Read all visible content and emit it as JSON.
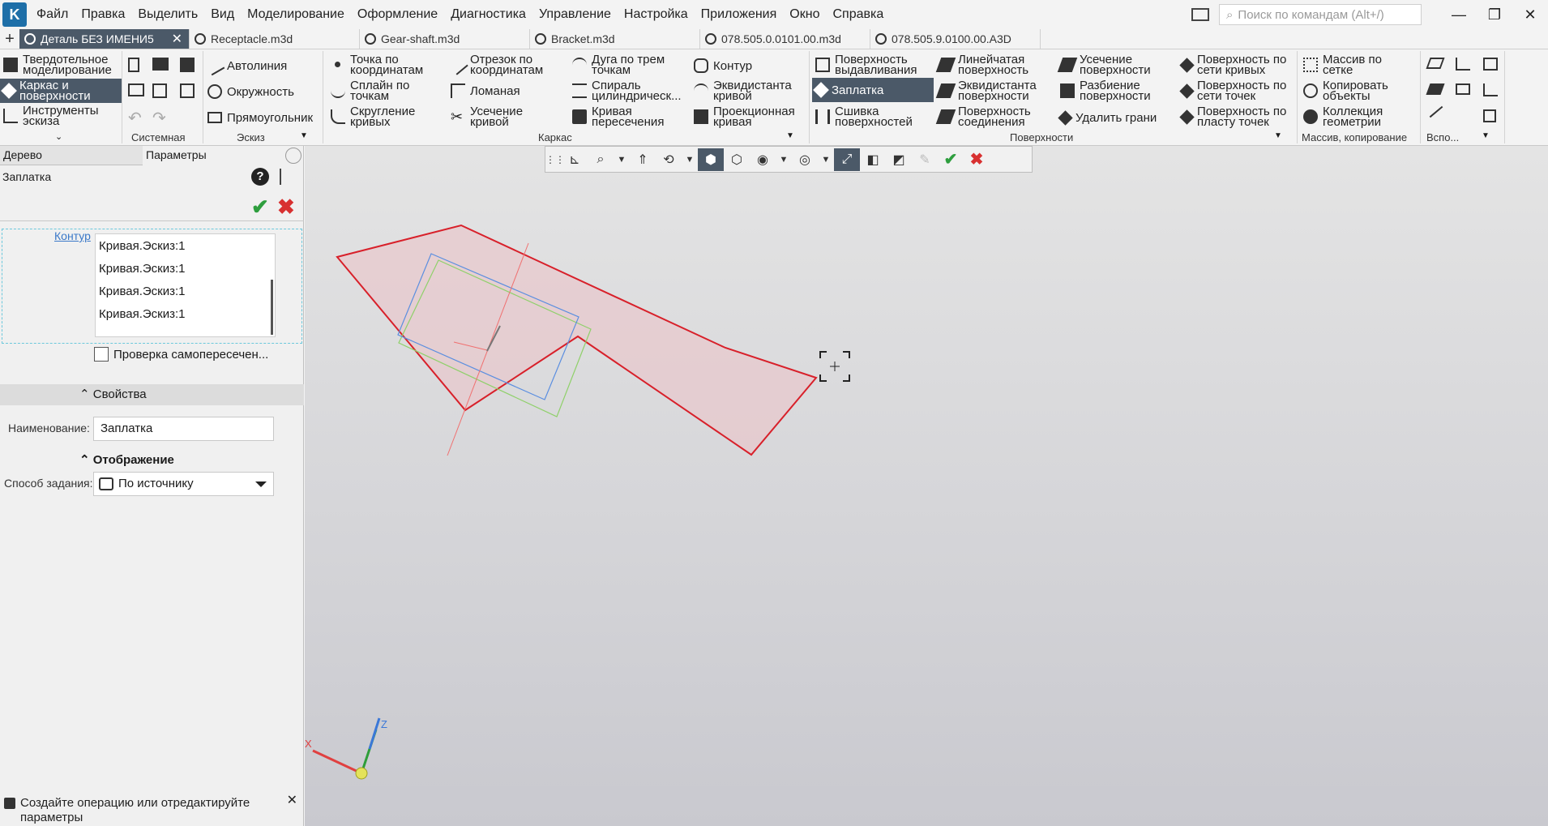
{
  "app": {
    "menu": [
      "Файл",
      "Правка",
      "Выделить",
      "Вид",
      "Моделирование",
      "Оформление",
      "Диагностика",
      "Управление",
      "Настройка",
      "Приложения",
      "Окно",
      "Справка"
    ],
    "search_placeholder": "Поиск по командам (Alt+/)",
    "window_controls": [
      "—",
      "❐",
      "✕"
    ]
  },
  "tabs": [
    {
      "label": "Деталь БЕЗ ИМЕНИ5",
      "active": true
    },
    {
      "label": "Receptacle.m3d",
      "active": false
    },
    {
      "label": "Gear-shaft.m3d",
      "active": false
    },
    {
      "label": "Bracket.m3d",
      "active": false
    },
    {
      "label": "078.505.0.0101.00.m3d",
      "active": false
    },
    {
      "label": "078.505.9.0100.00.А3D",
      "active": false
    }
  ],
  "ribbon": {
    "modes": {
      "solid": "Твердотельное моделирование",
      "frame": "Каркас и поверхности",
      "sketch_tools": "Инструменты эскиза"
    },
    "sketch": {
      "autoline": "Автолиния",
      "circle": "Окружность",
      "rect": "Прямоугольник"
    },
    "frame": {
      "point_coords": "Точка по координатам",
      "spline_points": "Сплайн по точкам",
      "round_curves": "Скругление кривых",
      "segment_coords": "Отрезок по координатам",
      "polyline": "Ломаная",
      "trim_curve": "Усечение кривой",
      "arc_3pts": "Дуга по трем точкам",
      "cyl_spiral": "Спираль цилиндрическ...",
      "intersection_curve": "Кривая пересечения",
      "contour": "Контур",
      "curve_offset": "Эквидистанта кривой",
      "projection_curve": "Проекционная кривая"
    },
    "surfaces": {
      "extrude_surface": "Поверхность выдавливания",
      "patch": "Заплатка",
      "stitch": "Сшивка поверхностей",
      "ruled": "Линейчатая поверхность",
      "surface_offset": "Эквидистанта поверхности",
      "blend_surface": "Поверхность соединения",
      "trim_surface": "Усечение поверхности",
      "split_surface": "Разбиение поверхности",
      "delete_faces": "Удалить грани",
      "curve_net": "Поверхность по сети кривых",
      "point_net": "Поверхность по сети точек",
      "point_cloud": "Поверхность по пласту точек"
    },
    "array": {
      "grid_array": "Массив по сетке",
      "copy_objects": "Копировать объекты",
      "geometry_collection": "Коллекция геометрии"
    },
    "group_labels": {
      "system": "Системная",
      "sketch": "Эскиз",
      "frame": "Каркас",
      "surfaces": "Поверхности",
      "array": "Массив, копирование",
      "aux": "Вспо..."
    }
  },
  "panel": {
    "tabs": [
      "Дерево",
      "Параметры"
    ],
    "operation_title": "Заплатка",
    "contour_label": "Контур",
    "contour_items": [
      "Кривая.Эскиз:1",
      "Кривая.Эскиз:1",
      "Кривая.Эскиз:1",
      "Кривая.Эскиз:1"
    ],
    "self_intersection_check": "Проверка самопересечен...",
    "properties_header": "Свойства",
    "name_label": "Наименование:",
    "name_value": "Заплатка",
    "display_header": "Отображение",
    "mode_label": "Способ задания:",
    "mode_value": "По источнику",
    "status_text": "Создайте операцию или отредактируйте параметры"
  },
  "colors": {
    "accent": "#4b5968",
    "ok": "#2e9e3e",
    "cancel": "#d83030",
    "patch_edge": "#d8202a",
    "patch_fill": "#e8c8cc"
  }
}
